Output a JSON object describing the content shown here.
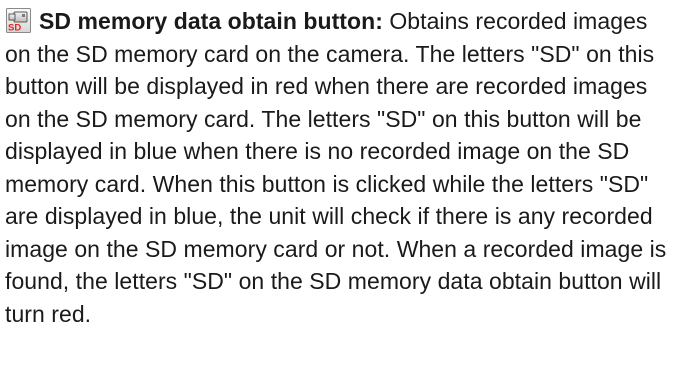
{
  "entry": {
    "icon": "sd-memory-data-obtain-button-icon",
    "icon_label": "SD",
    "icon_label_color": "#e8241c",
    "title": "SD memory data obtain button:",
    "description": " Obtains recorded images on the SD memory card on the camera. The letters \"SD\" on this button will be displayed in red when there are recorded images on the SD memory card. The letters \"SD\" on this button will be displayed in blue when there is no recorded image on the SD memory card. When this button is clicked while the letters \"SD\" are displayed in blue, the unit will check if there is any recorded image on the SD memory card or not. When a recorded image is found, the letters \"SD\" on the SD memory data obtain button will turn red."
  }
}
